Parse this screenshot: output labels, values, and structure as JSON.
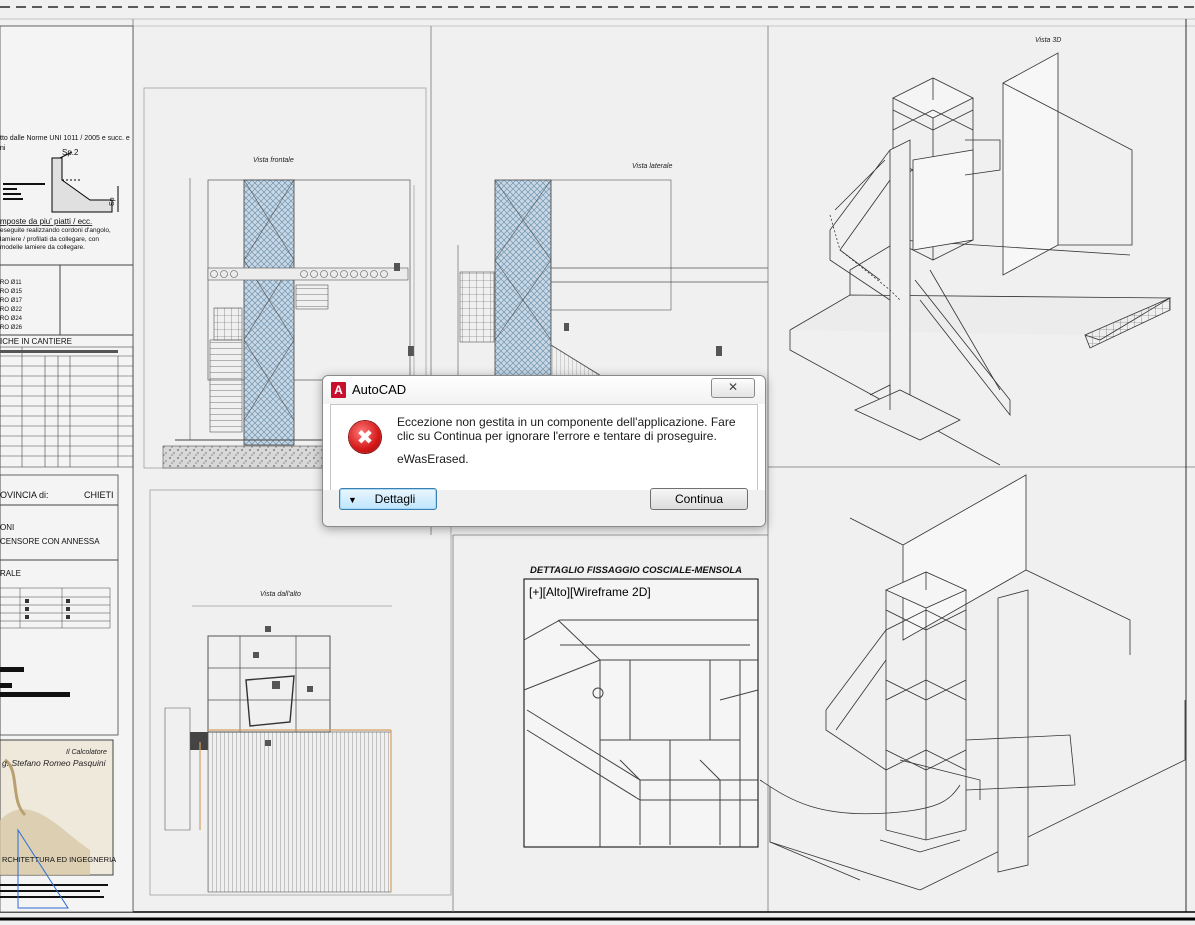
{
  "dialog": {
    "title": "AutoCAD",
    "app_icon": "A",
    "close_glyph": "✕",
    "message": "Eccezione non gestita in un componente dell'applicazione. Fare clic su Continua per ignorare l'errore e tentare di proseguire.",
    "error_code": "eWasErased.",
    "details_button": "Dettagli",
    "continue_button": "Continua",
    "error_icon": "error-icon"
  },
  "drawing": {
    "view_front_title": "Vista frontale",
    "view_side_title": "Vista laterale",
    "view_top_title": "Vista dall'alto",
    "view_3d_title": "Vista 3D",
    "detail_title": "DETTAGLIO FISSAGGIO COSCIALE-MENSOLA",
    "viewport_label": "[+][Alto][Wireframe 2D]"
  },
  "title_block": {
    "norm_text_1": "tto dalle Norme UNI 1011 / 2005 e succ. e",
    "norm_text_2": "ni",
    "weld_label": "Sp.2",
    "weld_side_label": "Sp",
    "composite_heading": "mposte da piu' piatti / ecc.",
    "composite_text_1": "eseguite realizzando cordoni d'angolo,",
    "composite_text_2": "lamiere / profilati da collegare, con",
    "composite_text_3": "modelle lamiere da collegare.",
    "rebar_rows": [
      "RO  Ø11",
      "RO  Ø15",
      "RO  Ø17",
      "RO  Ø22",
      "RO  Ø24",
      "RO  Ø26"
    ],
    "site_checks": "ICHE IN CANTIERE",
    "province_label": "OVINCIA di:",
    "province_value": "CHIETI",
    "line_a": "ONI",
    "line_b": "CENSORE CON ANNESSA",
    "line_c": "RALE",
    "calc_label": "Il Calcolatore",
    "engineer": "g. Stefano Romeo Pasquini",
    "firm": "RCHITETTURA ED INGEGNERIA"
  },
  "colors": {
    "background": "#f0f0f0",
    "line": "#3a3a3a",
    "mesh": "#8fb0c8",
    "dialog_error": "#d41818"
  }
}
